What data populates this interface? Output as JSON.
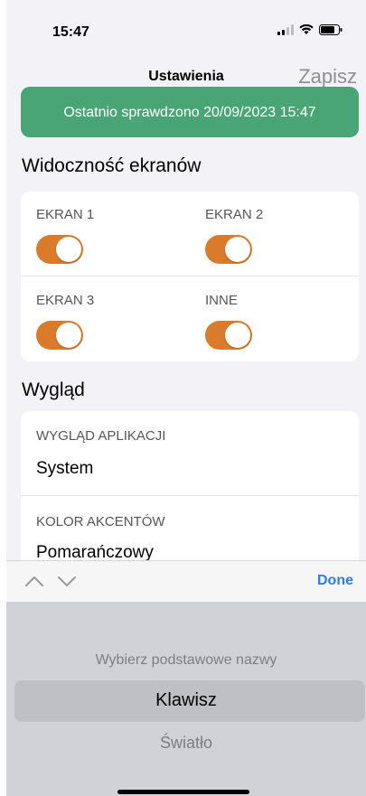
{
  "status_bar": {
    "time": "15:47"
  },
  "nav": {
    "title": "Ustawienia",
    "save_label": "Zapisz"
  },
  "banner": {
    "text": "Ostatnio sprawdzono 20/09/2023 15:47"
  },
  "visibility": {
    "title": "Widoczność ekranów",
    "items": [
      {
        "label": "EKRAN 1",
        "on": true
      },
      {
        "label": "EKRAN 2",
        "on": true
      },
      {
        "label": "EKRAN 3",
        "on": true
      },
      {
        "label": "INNE",
        "on": true
      }
    ]
  },
  "appearance": {
    "title": "Wygląd",
    "app_look": {
      "label": "WYGLĄD APLIKACJI",
      "value": "System"
    },
    "accent": {
      "label": "KOLOR AKCENTÓW",
      "value": "Pomarańczowy"
    }
  },
  "keyboard_toolbar": {
    "done_label": "Done"
  },
  "picker": {
    "options": [
      "Wybierz podstawowe nazwy",
      "Klawisz",
      "Światło"
    ],
    "selected": "Klawisz"
  },
  "colors": {
    "accent": "#d97b2a",
    "banner": "#4aa576",
    "done": "#2f7de0"
  }
}
